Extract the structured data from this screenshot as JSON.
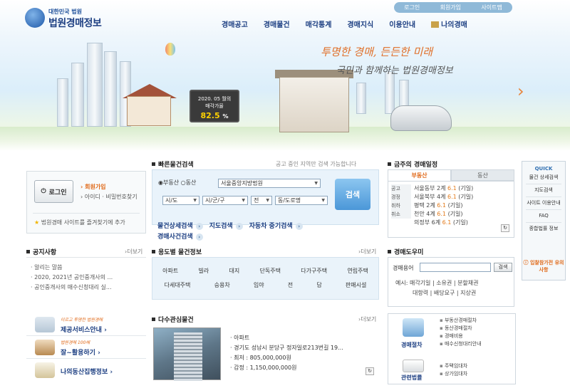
{
  "logo": {
    "small": "대한민국 법원",
    "main": "법원경매정보"
  },
  "util": [
    "로그인",
    "회원가입",
    "사이트맵"
  ],
  "gnb": [
    "경매공고",
    "경매물건",
    "매각통계",
    "경매지식",
    "이용안내",
    "나의경매"
  ],
  "banner": {
    "slogan1": "투명한 경매, 든든한 미래",
    "slogan2": "국민과 함께하는 법원경매정보",
    "sign_line1": "2020. 05 월의",
    "sign_line2": "매각가율",
    "sign_rate": "82.5",
    "sign_unit": "%",
    "next_arrow": "›"
  },
  "login": {
    "button": "로그인",
    "join": "회원가입",
    "idpw": "아이디 · 비밀번호찾기",
    "favorite": "법원경매 사이트를 즐겨찾기에 추가"
  },
  "quick_search": {
    "title": "빠른물건검색",
    "hint": "공고 중인 지역만 검색 가능합니다",
    "radio1": "부동산",
    "radio2": "동산",
    "court": "서울중앙지방법원",
    "sido": "시/도",
    "sigungu": "시/군/구",
    "dong": "전",
    "road": "동/도로명",
    "button": "검색",
    "links": [
      "물건상세검색",
      "지도검색",
      "자동차 중기검색",
      "경매사건검색"
    ]
  },
  "schedule": {
    "title": "금주의 경매일정",
    "tabs": [
      "부동산",
      "동산"
    ],
    "side": [
      "공고",
      "경정",
      "취하",
      "취소"
    ],
    "rows": [
      {
        "court": "서울동부",
        "cnt": "2계",
        "date": "6.1",
        "note": "(기일)"
      },
      {
        "court": "서울북부",
        "cnt": "4계",
        "date": "6.1",
        "note": "(기일)"
      },
      {
        "court": "평택",
        "cnt": "2계",
        "date": "6.1",
        "note": "(기일)"
      },
      {
        "court": "천안",
        "cnt": "4계",
        "date": "6.1",
        "note": "(기일)"
      },
      {
        "court": "의정부",
        "cnt": "6계",
        "date": "6.1",
        "note": "(기일)"
      }
    ]
  },
  "quick": {
    "title": "QUICK",
    "items": [
      "물건 상세검색",
      "지도검색",
      "사이트 이용안내",
      "FAQ",
      "종합법률 정보"
    ],
    "bottom": "입찰참가전 유의사항"
  },
  "notice": {
    "title": "공지사항",
    "more": "더보기",
    "items": [
      "알리는 말씀",
      "2020, 2021년 공인중개사의 ...",
      "공인중개사의 매수신청대리 실..."
    ]
  },
  "usage": {
    "title": "용도별 물건정보",
    "more": "더보기",
    "row1": [
      "아파트",
      "빌라",
      "대지",
      "단독주택",
      "다가구주택",
      "연립주택"
    ],
    "row2": [
      "다세대주택",
      "승용차",
      "임야",
      "전",
      "답",
      "판매시설"
    ]
  },
  "tool": {
    "title": "경매도우미",
    "label": "경매용어",
    "button": "검색",
    "line1": [
      "예시: 매각기일",
      "소유권",
      "분할채권"
    ],
    "line2": [
      "대항력",
      "배당요구",
      "지상권"
    ]
  },
  "promo": [
    {
      "sub": "이르고 투명한 법원경매",
      "main": "제공서비스안내"
    },
    {
      "sub": "법원경매 100배",
      "main": "잘~활용하기"
    },
    {
      "sub": "",
      "main": "나의동산집행정보"
    }
  ],
  "interest": {
    "title": "다수관심물건",
    "more": "더보기",
    "type": "아파트",
    "address": "경기도 성남시 분당구 정자일로213번길 19...",
    "min": "최저 : 805,000,000원",
    "appraisal": "감정 : 1,150,000,000원"
  },
  "guide": {
    "proc": "경매절차",
    "law": "관련법률",
    "proc_items": [
      "부동산경매절차",
      "동산경매절차",
      "경매비용",
      "매수신청대리안내"
    ],
    "law_items": [
      "주택임대차",
      "상가임대차"
    ]
  }
}
